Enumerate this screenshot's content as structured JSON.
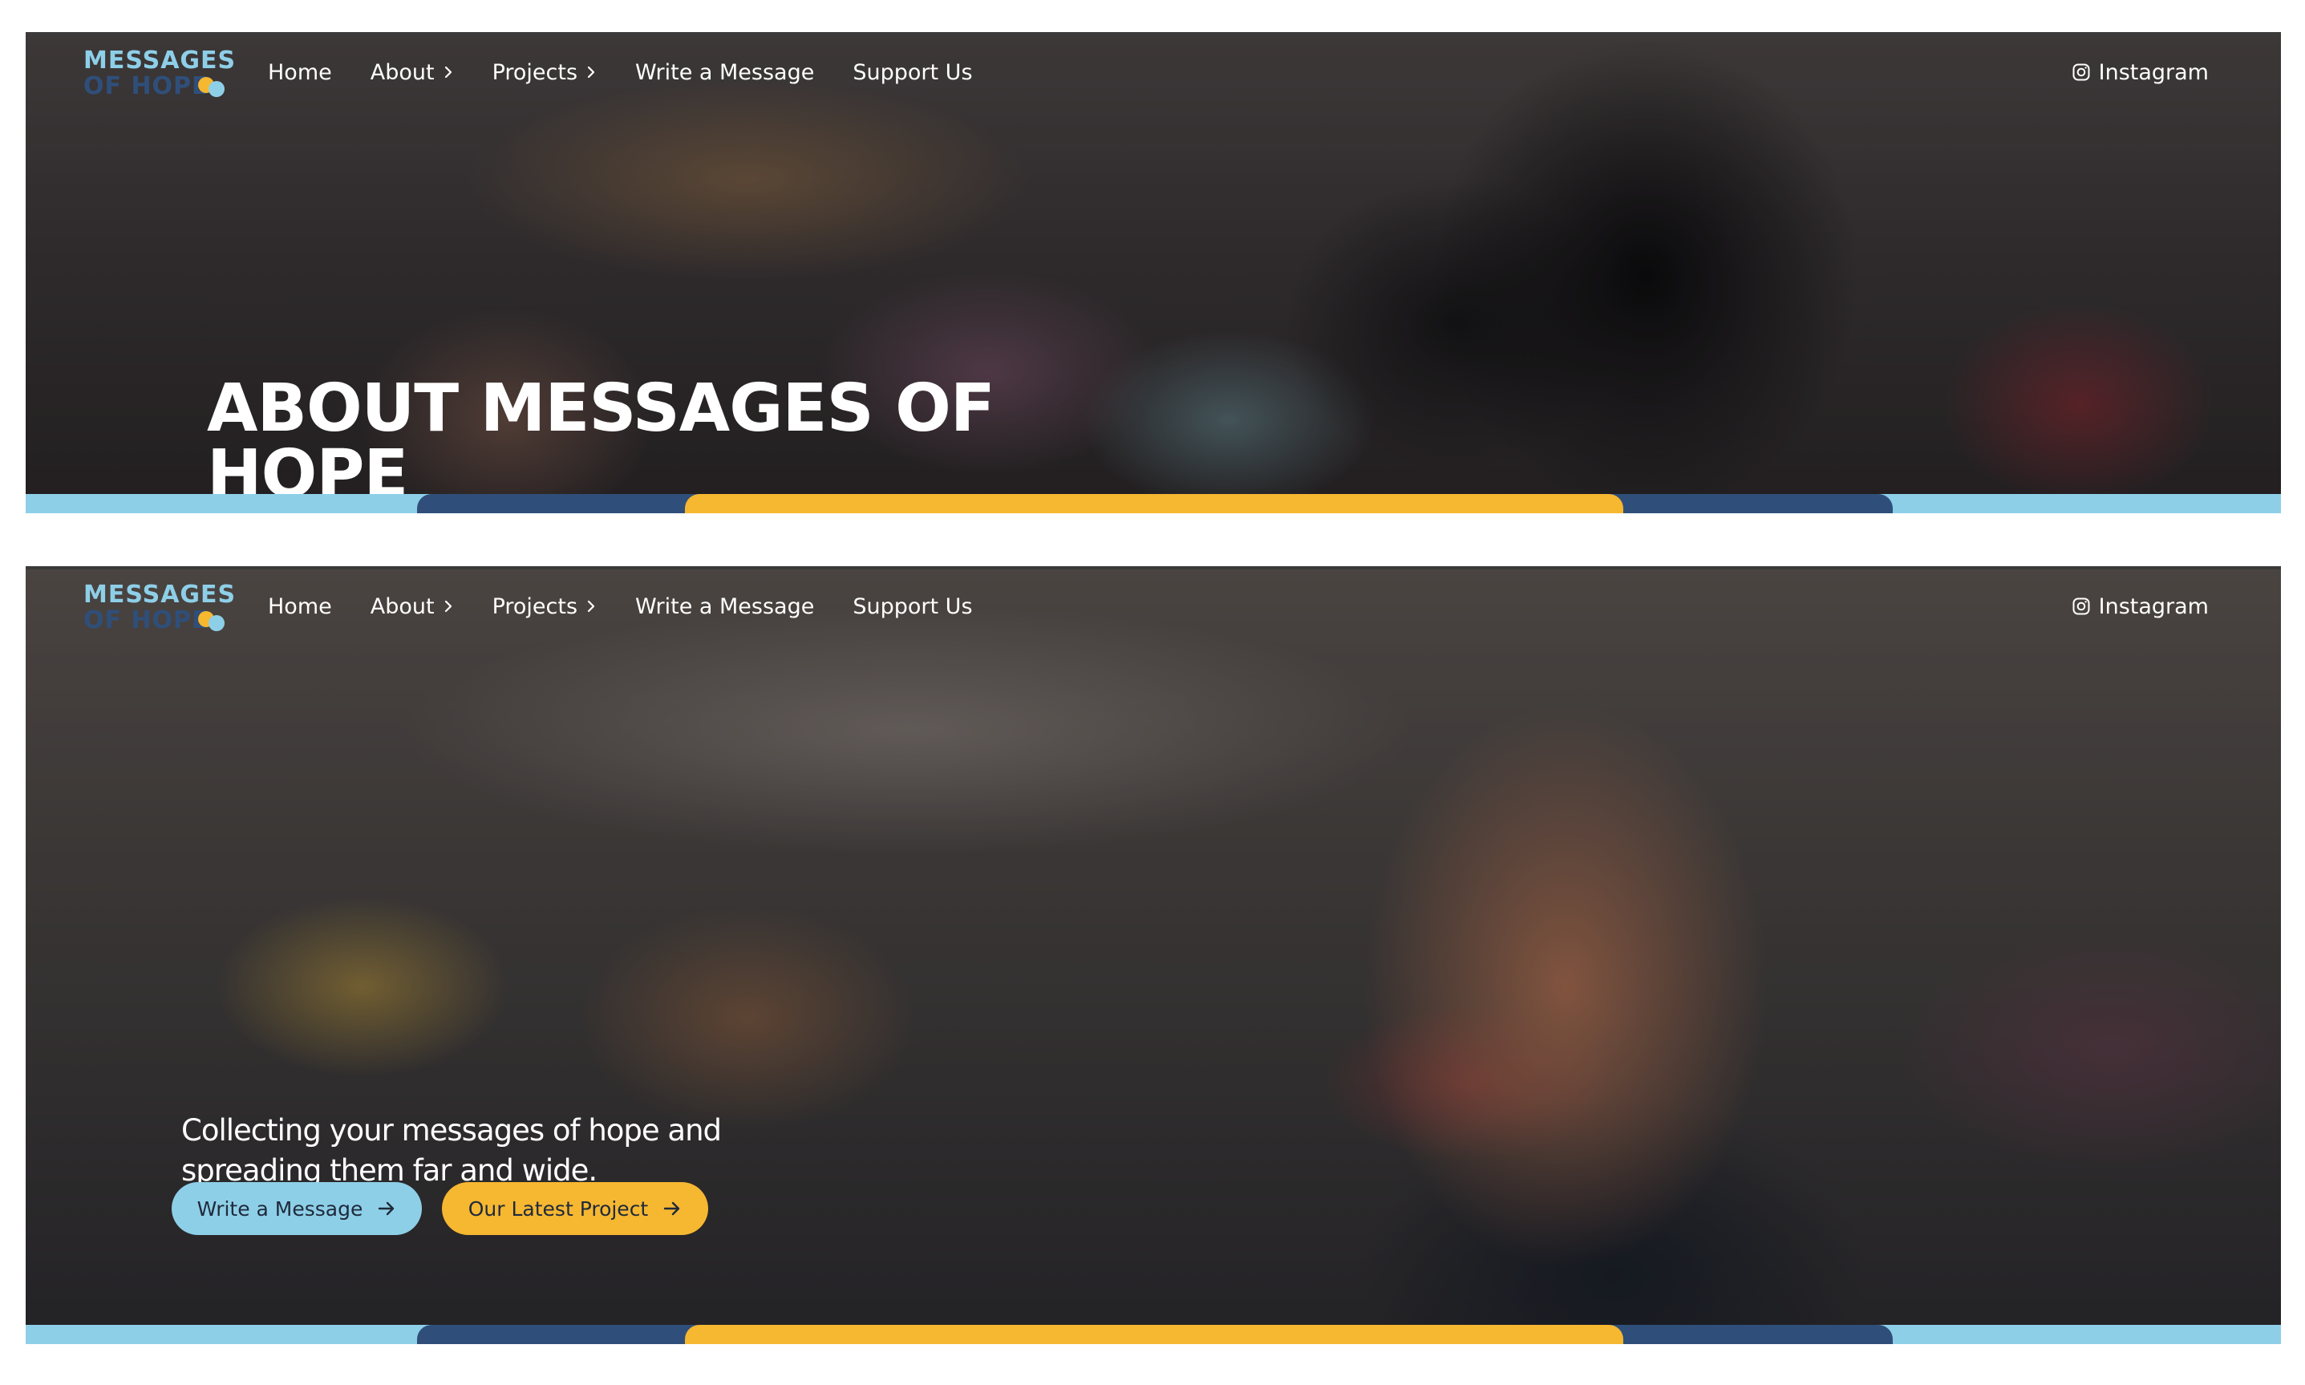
{
  "brand": {
    "logo_line_1": "MESSAGES",
    "logo_line_2": "OF HOPE",
    "colors": {
      "light_blue": "#8ecfe8",
      "navy": "#2f4f7a",
      "yellow": "#f6b731"
    }
  },
  "nav": {
    "items": [
      {
        "label": "Home",
        "has_submenu": false
      },
      {
        "label": "About",
        "has_submenu": true,
        "icon": "chevron-right-icon"
      },
      {
        "label": "Projects",
        "has_submenu": true,
        "icon": "chevron-right-icon"
      },
      {
        "label": "Write a Message",
        "has_submenu": false
      },
      {
        "label": "Support Us",
        "has_submenu": false
      }
    ],
    "instagram": {
      "label": "Instagram",
      "icon": "instagram-icon"
    }
  },
  "about_page": {
    "title": "ABOUT MESSAGES OF HOPE"
  },
  "home_page": {
    "tagline": "Collecting your messages of hope and spreading them far and wide.",
    "buttons": [
      {
        "label": "Write a Message",
        "icon": "arrow-right-icon"
      },
      {
        "label": "Our Latest Project",
        "icon": "arrow-right-icon"
      }
    ]
  }
}
